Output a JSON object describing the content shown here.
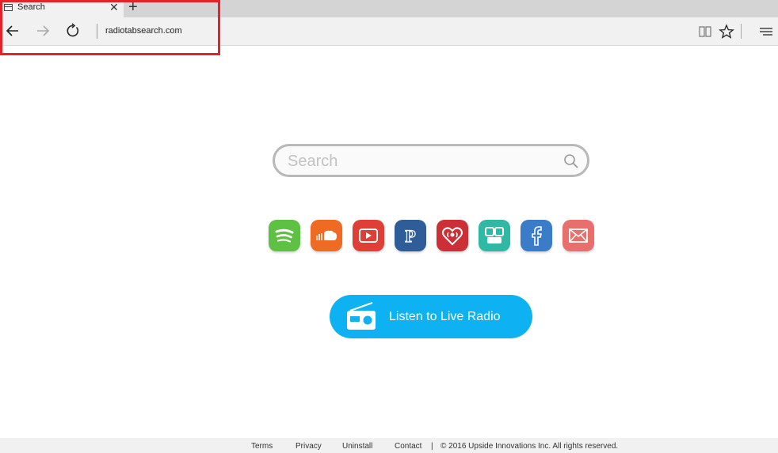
{
  "browser": {
    "tab": {
      "title": "Search",
      "close_glyph": "✕",
      "icon": "page-icon"
    },
    "new_tab_glyph": "+",
    "toolbar": {
      "back_icon": "back-arrow-icon",
      "forward_icon": "forward-arrow-icon",
      "refresh_icon": "refresh-icon",
      "address": "radiotabsearch.com",
      "reading_view_icon": "book-icon",
      "favorite_icon": "star-icon",
      "menu_icon": "hamburger-menu-icon"
    },
    "highlight_color": "#e3232c"
  },
  "search": {
    "placeholder": "Search",
    "value": "",
    "icon": "magnifier-icon"
  },
  "apps": [
    {
      "name": "spotify",
      "icon": "spotify-icon",
      "color": "#5fc143"
    },
    {
      "name": "soundcloud",
      "icon": "soundcloud-icon",
      "color": "#ef6b23"
    },
    {
      "name": "youtube",
      "icon": "youtube-icon",
      "color": "#e03f38"
    },
    {
      "name": "pandora",
      "icon": "pandora-icon",
      "color": "#2e5d98"
    },
    {
      "name": "iheartradio",
      "icon": "iheartradio-icon",
      "color": "#cc2f36"
    },
    {
      "name": "tunein",
      "icon": "tunein-icon",
      "color": "#2fb8a3"
    },
    {
      "name": "facebook",
      "icon": "facebook-icon",
      "color": "#3a7cc8"
    },
    {
      "name": "mail",
      "icon": "envelope-icon",
      "color": "#e86f6c"
    }
  ],
  "radio_button": {
    "label": "Listen to Live Radio",
    "icon": "radio-icon",
    "color": "#0eb2f2"
  },
  "footer": {
    "terms": "Terms",
    "privacy": "Privacy",
    "uninstall": "Uninstall",
    "contact": "Contact",
    "separator": "|",
    "copyright": "© 2016 Upside Innovations Inc. All rights reserved."
  }
}
